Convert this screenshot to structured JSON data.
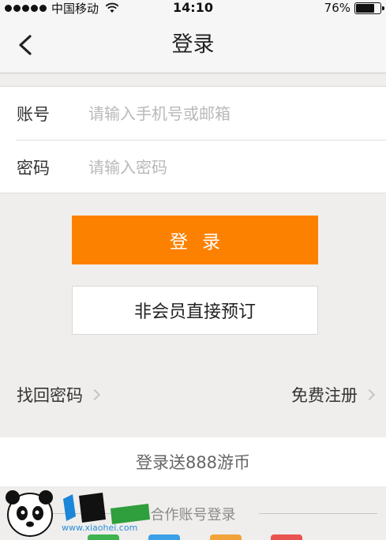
{
  "status_bar": {
    "carrier": "中国移动",
    "time": "14:10",
    "battery": "76%"
  },
  "nav": {
    "title": "登录"
  },
  "form": {
    "account_label": "账号",
    "account_placeholder": "请输入手机号或邮箱",
    "password_label": "密码",
    "password_placeholder": "请输入密码"
  },
  "buttons": {
    "login": "登录",
    "guest_booking": "非会员直接预订"
  },
  "links": {
    "forgot_password": "找回密码",
    "register": "免费注册"
  },
  "promo": "登录送888游币",
  "partner_login_label": "合作账号登录",
  "watermark": {
    "url": "www.xiaohei.com"
  },
  "colors": {
    "accent": "#fd8100",
    "background": "#efeeec"
  }
}
